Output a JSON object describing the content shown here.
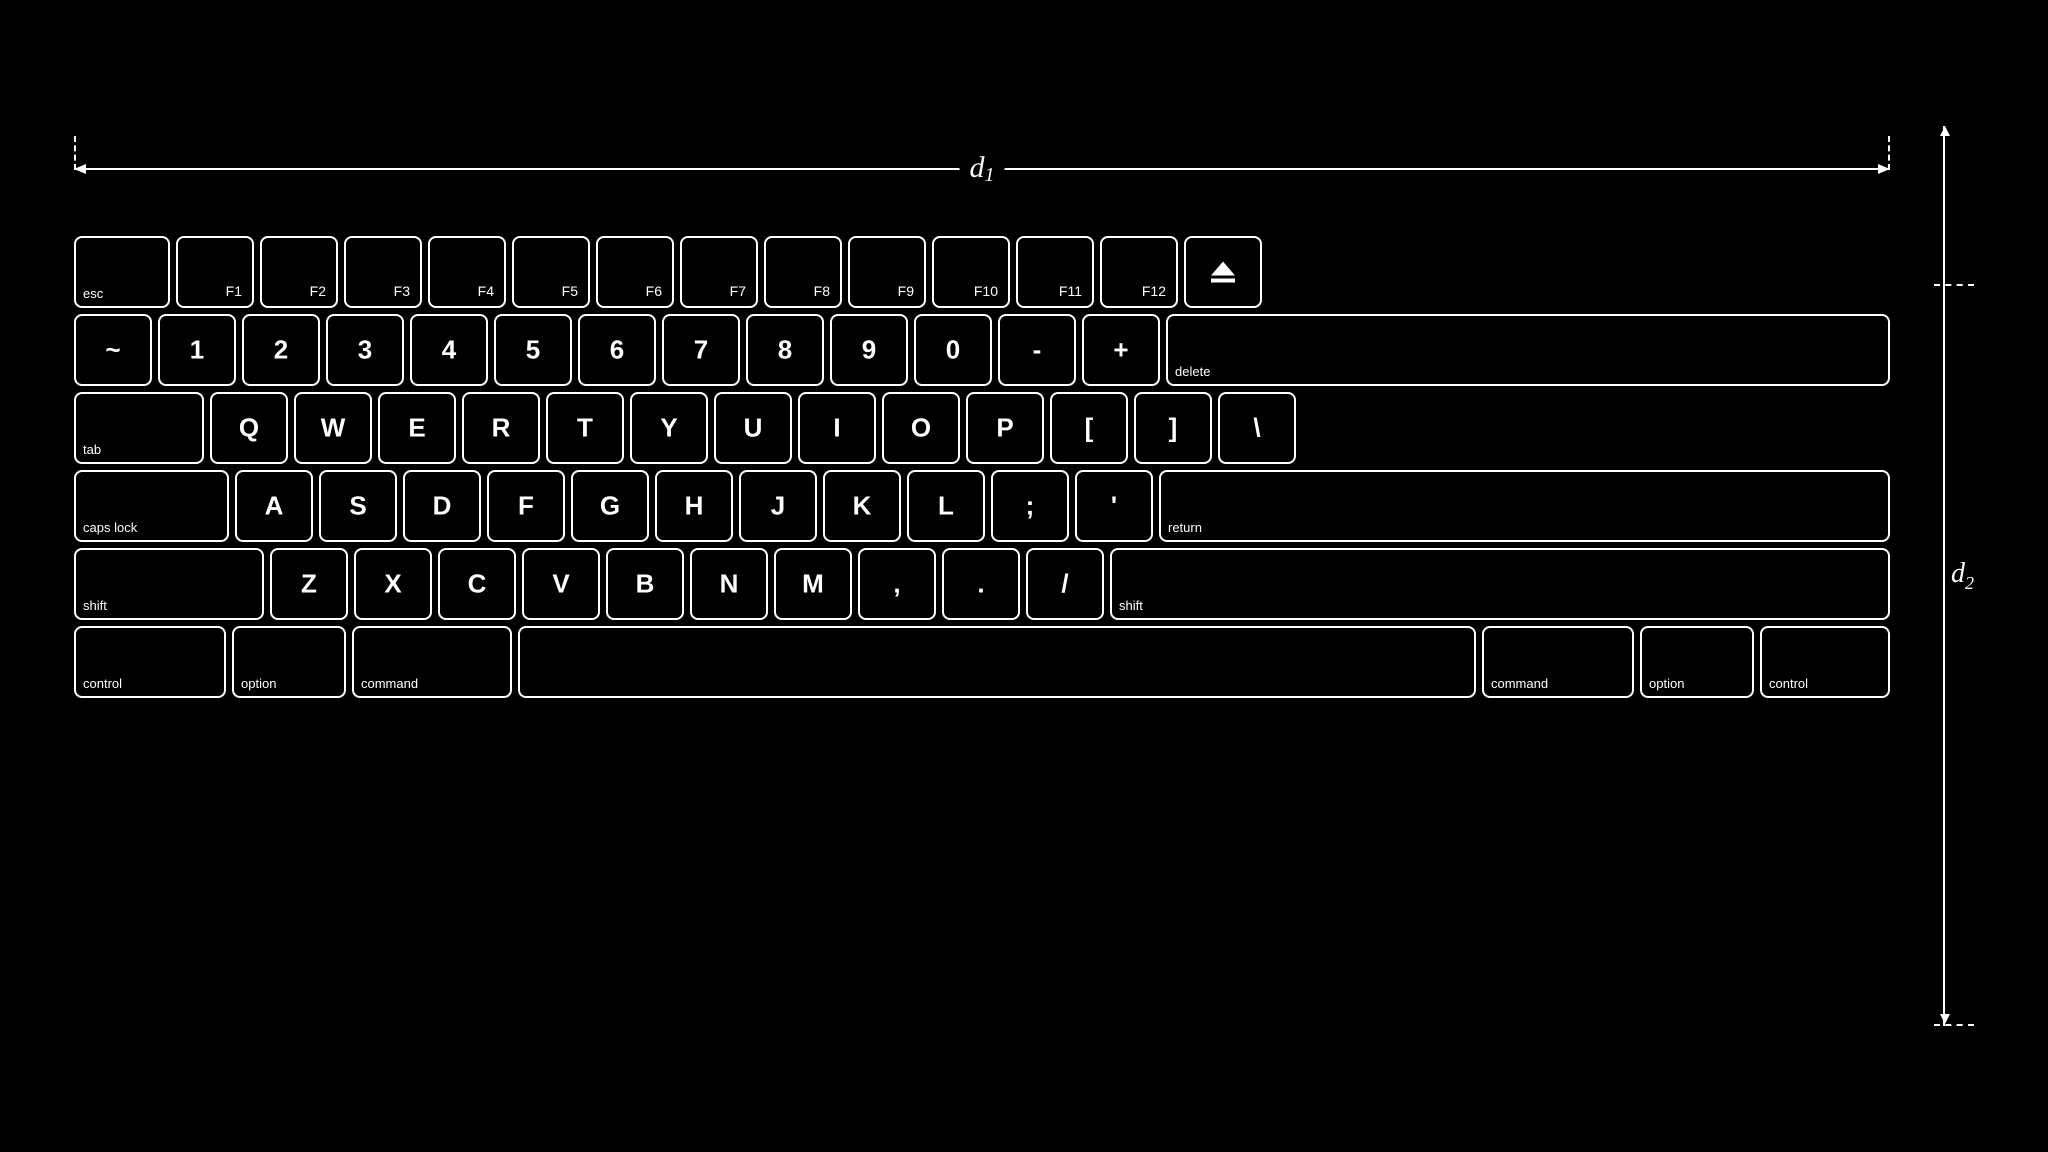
{
  "dimensions": {
    "d1_label": "d",
    "d1_sub": "1",
    "d2_label": "d",
    "d2_sub": "2"
  },
  "keyboard": {
    "rows": {
      "fn_row": [
        "esc",
        "F1",
        "F2",
        "F3",
        "F4",
        "F5",
        "F6",
        "F7",
        "F8",
        "F9",
        "F10",
        "F11",
        "F12",
        "⏏"
      ],
      "number_row": [
        "~",
        "1",
        "2",
        "3",
        "4",
        "5",
        "6",
        "7",
        "8",
        "9",
        "0",
        "-",
        "+",
        "delete"
      ],
      "tab_row": [
        "tab",
        "Q",
        "W",
        "E",
        "R",
        "T",
        "Y",
        "U",
        "I",
        "O",
        "P",
        "[",
        "]",
        "\\"
      ],
      "caps_row": [
        "caps lock",
        "A",
        "S",
        "D",
        "F",
        "G",
        "H",
        "J",
        "K",
        "L",
        ";",
        "'",
        "return"
      ],
      "shift_row": [
        "shift",
        "Z",
        "X",
        "C",
        "V",
        "B",
        "N",
        "M",
        ",",
        ".",
        "/",
        "shift"
      ],
      "bottom_row": [
        "control",
        "option",
        "command",
        "",
        "command",
        "option",
        "control"
      ]
    }
  }
}
